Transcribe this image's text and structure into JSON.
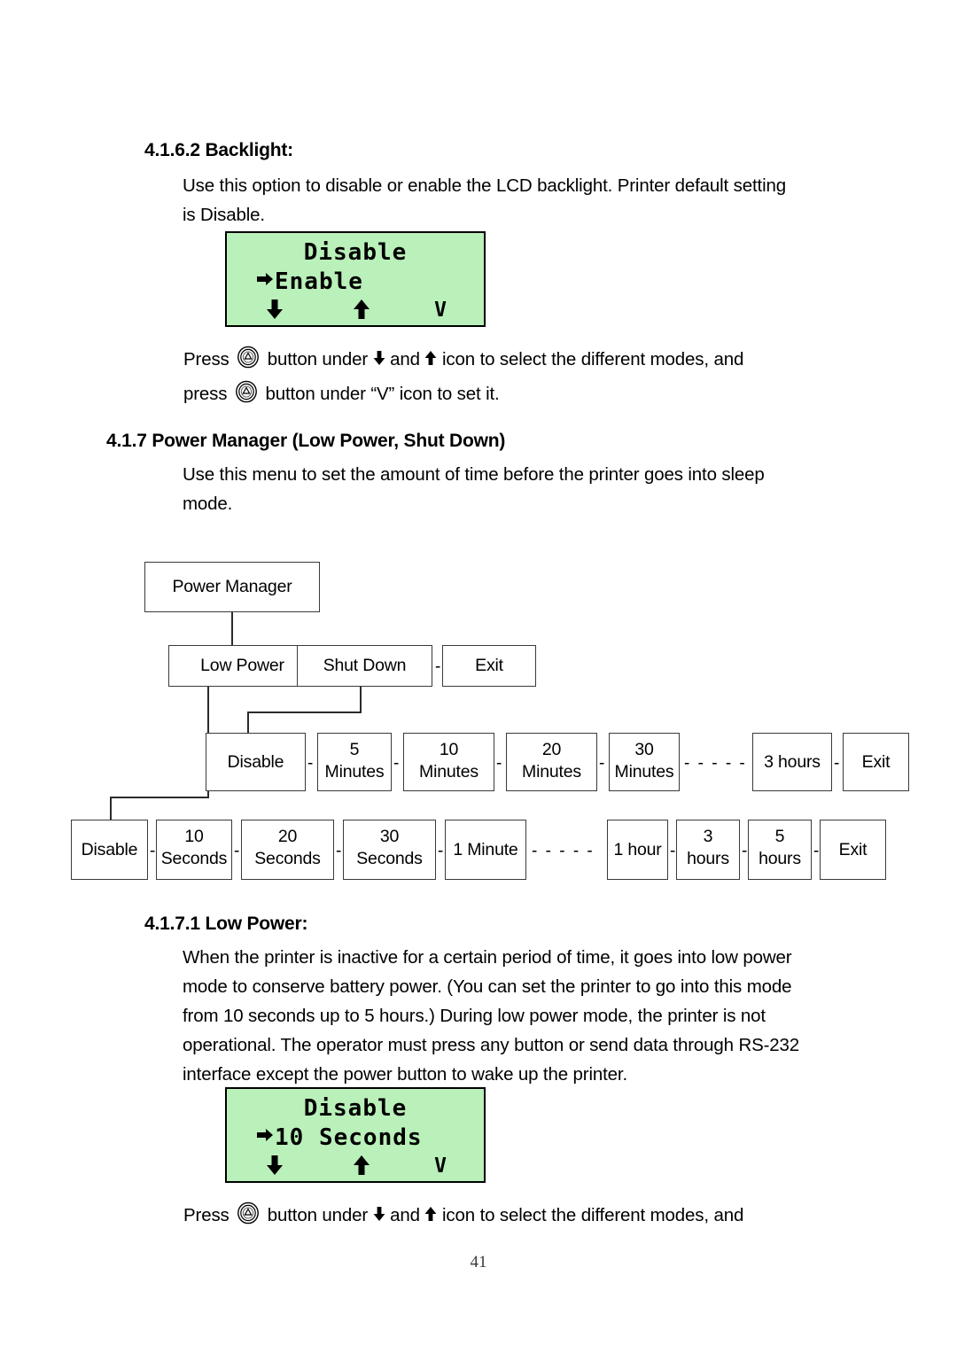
{
  "page": {
    "number": "41"
  },
  "section_backlight": {
    "heading": "4.1.6.2 Backlight:",
    "paragraph": [
      "Use this option to disable or enable the LCD backlight. Printer default setting",
      "is Disable."
    ]
  },
  "lcd_backlight": {
    "line1": "Disable",
    "line2_arrow": "right-arrow",
    "line2": "Enable",
    "key_down": "down-arrow",
    "key_up": "up-arrow",
    "key_enter": "V"
  },
  "press_instruction_1": {
    "seg1": "Press",
    "icon1": "printer-button-icon",
    "seg2": "button under",
    "icon_down": "down-arrow",
    "seg3": "and",
    "icon_up": "up-arrow",
    "seg4": "icon to select the different modes, and",
    "seg5": "press",
    "icon2": "printer-button-icon",
    "seg6": "button under “V” icon to set it."
  },
  "section_power_manager": {
    "heading": "4.1.7 Power Manager (Low Power, Shut Down)",
    "paragraph": [
      "Use this menu to set the amount of time before the printer goes into sleep",
      "mode."
    ]
  },
  "flowchart": {
    "root": "Power Manager",
    "level1": [
      "Low Power",
      "Shut Down",
      "Exit"
    ],
    "separator": "-",
    "ellipsis": "- - - - -",
    "shutdown_options": [
      {
        "l1": "Disable",
        "l2": ""
      },
      {
        "l1": "5",
        "l2": "Minutes"
      },
      {
        "l1": "10",
        "l2": "Minutes"
      },
      {
        "l1": "20",
        "l2": "Minutes"
      },
      {
        "l1": "30",
        "l2": "Minutes"
      },
      {
        "l1": "3 hours",
        "l2": ""
      },
      {
        "l1": "Exit",
        "l2": ""
      }
    ],
    "lowpower_options": [
      {
        "l1": "Disable",
        "l2": ""
      },
      {
        "l1": "10",
        "l2": "Seconds"
      },
      {
        "l1": "20",
        "l2": "Seconds"
      },
      {
        "l1": "30",
        "l2": "Seconds"
      },
      {
        "l1": "1 Minute",
        "l2": ""
      },
      {
        "l1": "1 hour",
        "l2": ""
      },
      {
        "l1": "3",
        "l2": "hours"
      },
      {
        "l1": "5",
        "l2": "hours"
      },
      {
        "l1": "Exit",
        "l2": ""
      }
    ]
  },
  "section_low_power": {
    "heading": "4.1.7.1 Low Power:",
    "paragraph": [
      "When the printer is inactive for a certain period of time, it goes into low power",
      "mode to conserve battery power. (You can set the printer to go into this mode",
      "from 10 seconds up to 5 hours.) During low power mode, the printer is not",
      "operational. The operator must press any button or send data through RS-232",
      "interface except the power button to wake up the printer."
    ]
  },
  "lcd_lowpower": {
    "line1": "Disable",
    "line2_arrow": "right-arrow",
    "line2": "10 Seconds",
    "key_down": "down-arrow",
    "key_up": "up-arrow",
    "key_enter": "V"
  },
  "press_instruction_2": {
    "seg1": "Press",
    "icon1": "printer-button-icon",
    "seg2": "button under",
    "icon_down": "down-arrow",
    "seg3": "and",
    "icon_up": "up-arrow",
    "seg4": "icon to select the different modes, and"
  },
  "colors": {
    "lcd_background": "#baf0ba",
    "lcd_border": "#000000",
    "box_border": "#3a3a3a",
    "text": "#000000"
  }
}
